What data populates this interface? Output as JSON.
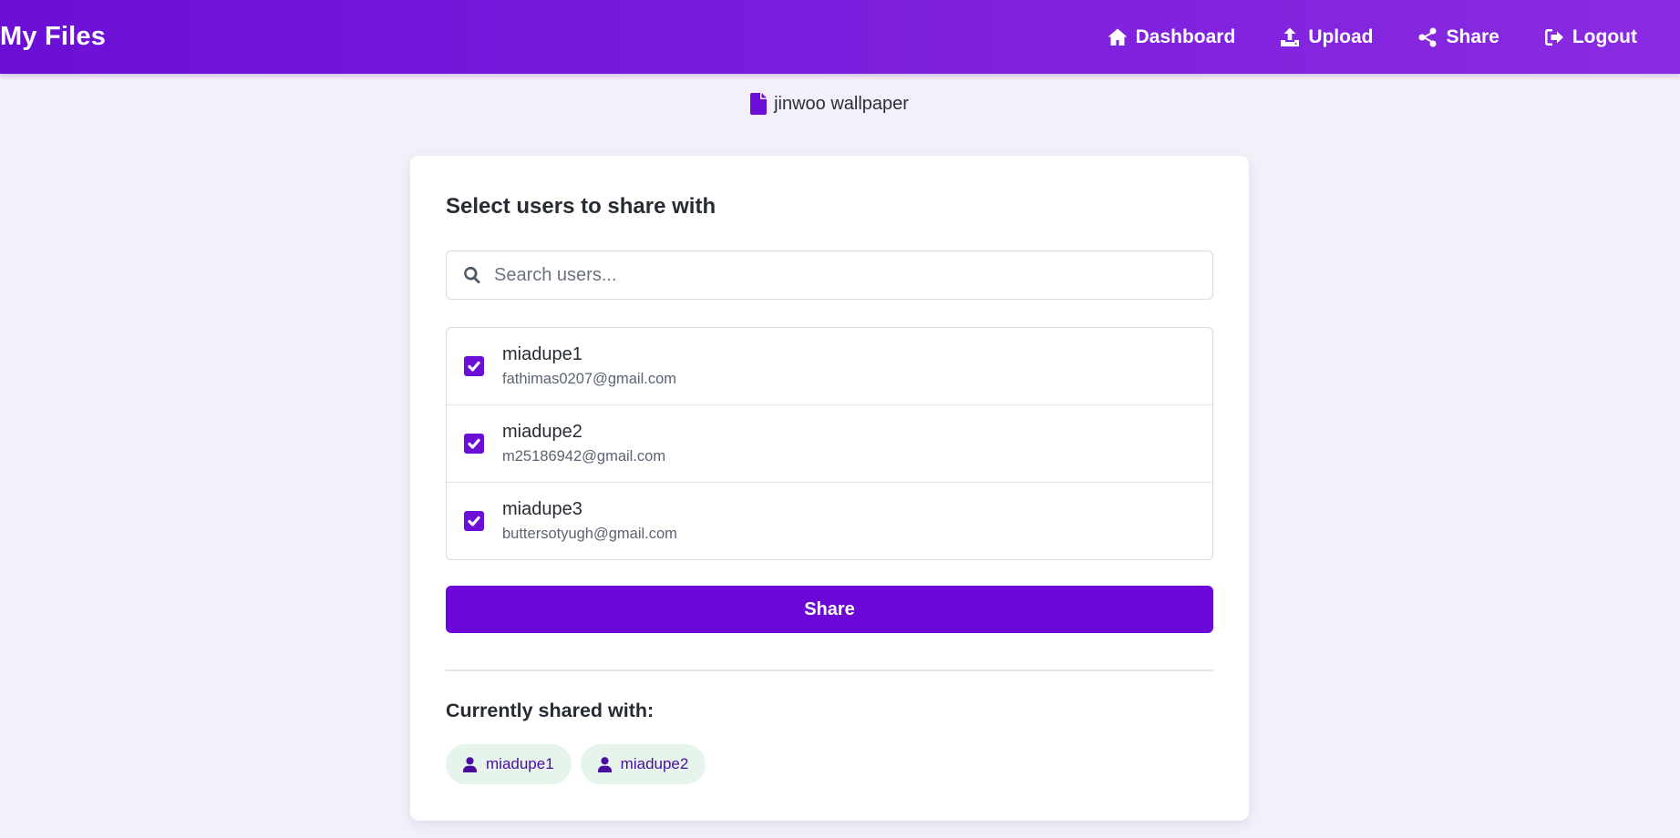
{
  "navbar": {
    "brand": "My Files",
    "links": [
      {
        "label": "Dashboard",
        "icon": "home-icon"
      },
      {
        "label": "Upload",
        "icon": "upload-icon"
      },
      {
        "label": "Share",
        "icon": "share-icon"
      },
      {
        "label": "Logout",
        "icon": "logout-icon"
      }
    ]
  },
  "file": {
    "name": "jinwoo wallpaper",
    "icon": "file-icon"
  },
  "card": {
    "heading": "Select users to share with",
    "search": {
      "placeholder": "Search users...",
      "value": "",
      "icon": "search-icon"
    },
    "users": [
      {
        "username": "miadupe1",
        "email": "fathimas0207@gmail.com",
        "checked": true
      },
      {
        "username": "miadupe2",
        "email": "m25186942@gmail.com",
        "checked": true
      },
      {
        "username": "miadupe3",
        "email": "buttersotyugh@gmail.com",
        "checked": true
      }
    ],
    "share_button": "Share",
    "shared_heading": "Currently shared with:",
    "shared_with": [
      {
        "username": "miadupe1",
        "icon": "user-icon"
      },
      {
        "username": "miadupe2",
        "icon": "user-icon"
      }
    ]
  },
  "colors": {
    "accent": "#6b08d8",
    "navbar_start": "#6c0fd6",
    "navbar_end": "#8a2be2",
    "background": "#f3f0fa",
    "chip_bg": "#e6f4ec",
    "chip_text": "#4a0e9e"
  }
}
